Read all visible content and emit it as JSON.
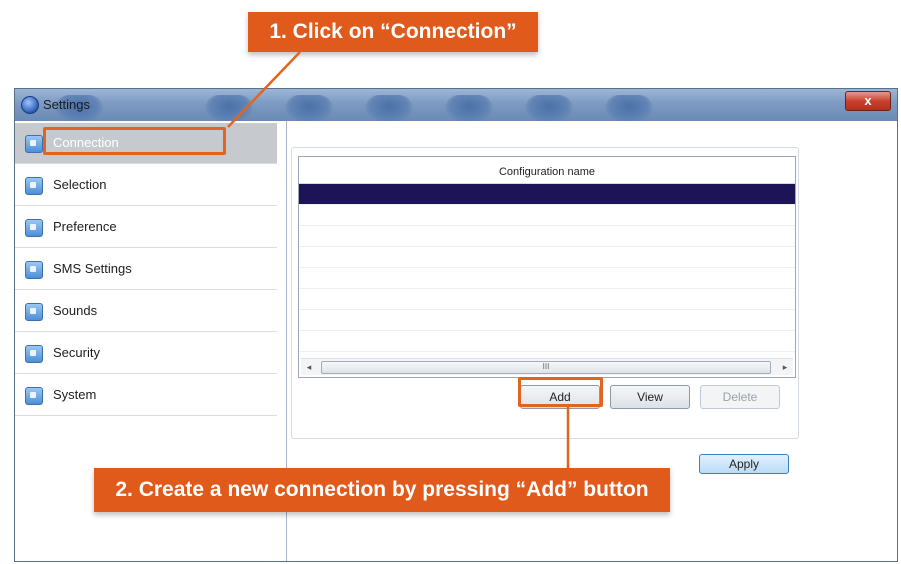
{
  "window": {
    "title": "Settings",
    "close_label": "x"
  },
  "sidebar": {
    "items": [
      {
        "label": "Connection",
        "icon": "connection-icon"
      },
      {
        "label": "Selection",
        "icon": "selection-icon"
      },
      {
        "label": "Preference",
        "icon": "preference-icon"
      },
      {
        "label": "SMS Settings",
        "icon": "sms-icon"
      },
      {
        "label": "Sounds",
        "icon": "speaker-icon"
      },
      {
        "label": "Security",
        "icon": "security-icon"
      },
      {
        "label": "System",
        "icon": "system-icon"
      }
    ],
    "active": "Connection"
  },
  "grid": {
    "column_header": "Configuration name",
    "scroll_thumb": "III",
    "scroll_left": "◂",
    "scroll_right": "▸"
  },
  "buttons": {
    "add": "Add",
    "view": "View",
    "delete": "Delete",
    "apply": "Apply"
  },
  "annotations": {
    "step1": "1. Click on “Connection”",
    "step2": "2. Create a new connection by pressing “Add” button"
  },
  "colors": {
    "callout": "#e05a1c",
    "selected_row": "#1c1456",
    "highlight": "#e2651f"
  }
}
